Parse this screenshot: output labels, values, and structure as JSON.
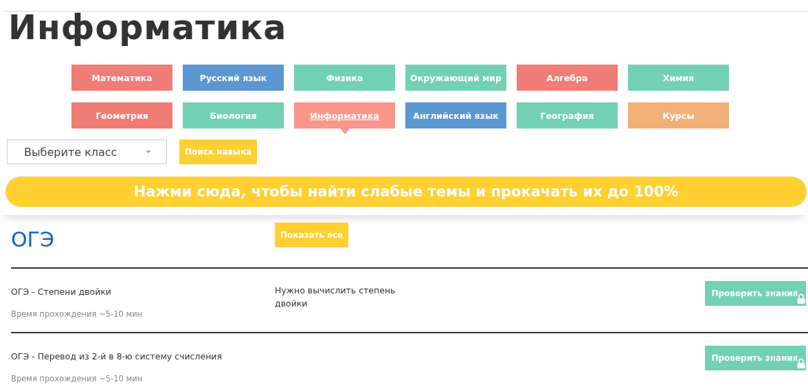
{
  "page_title": "Информатика",
  "subjects": [
    {
      "label": "Математика",
      "color": "#f07c76",
      "selected": false
    },
    {
      "label": "Русский язык",
      "color": "#5b97d0",
      "selected": false
    },
    {
      "label": "Физика",
      "color": "#72d1b4",
      "selected": false
    },
    {
      "label": "Окружающий мир",
      "color": "#72d1b4",
      "selected": false
    },
    {
      "label": "Алгебра",
      "color": "#f07c76",
      "selected": false
    },
    {
      "label": "Химия",
      "color": "#72d1b4",
      "selected": false
    },
    {
      "label": "Геометрия",
      "color": "#f07c76",
      "selected": false
    },
    {
      "label": "Биология",
      "color": "#72d1b4",
      "selected": false
    },
    {
      "label": "Информатика",
      "color": "#f8968c",
      "selected": true
    },
    {
      "label": "Английский язык",
      "color": "#5b97d0",
      "selected": false
    },
    {
      "label": "География",
      "color": "#72d1b4",
      "selected": false
    },
    {
      "label": "Курсы",
      "color": "#f1b076",
      "selected": false
    }
  ],
  "class_select": {
    "placeholder": "Выберите класс"
  },
  "skill_search_button": "Поиск навыка",
  "banner": "Нажми сюда, чтобы найти слабые темы и прокачать их до 100%",
  "section": {
    "title": "ОГЭ",
    "show_all_button": "Показать все",
    "topics": [
      {
        "title": "ОГЭ - Степени двойки",
        "duration": "Время прохождения ~5-10 мин",
        "description": "Нужно вычислить степень двойки",
        "button": "Проверить знания",
        "locked": true
      },
      {
        "title": "ОГЭ - Перевод из 2-й в 8-ю систему счисления",
        "duration": "Время прохождения ~5-10 мин",
        "button": "Проверить знания",
        "locked": true
      }
    ]
  }
}
